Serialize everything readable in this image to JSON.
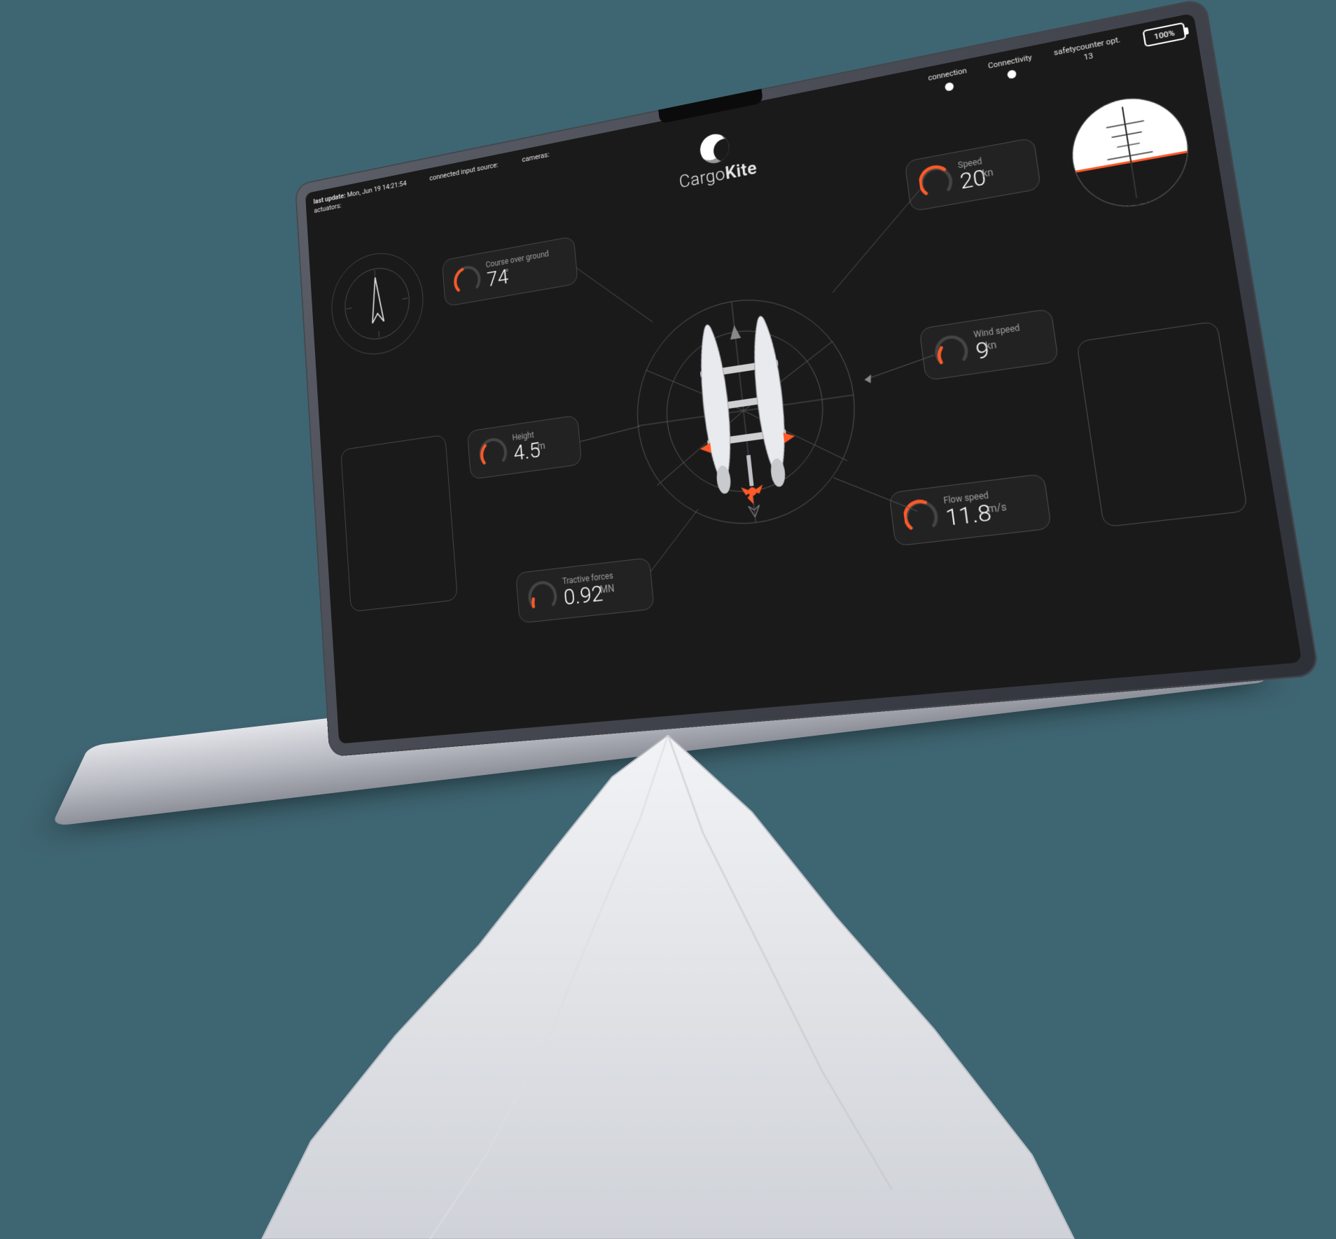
{
  "status": {
    "last_update_label": "last update:",
    "last_update_value": "Mon, Jun 19 14:21:54",
    "actuators_label": "actuators:",
    "input_source_label": "connected input source:",
    "cameras_label": "cameras:",
    "connection_label": "connection",
    "connectivity_label": "Connectivity",
    "safety_label": "safetycounter opt.",
    "safety_value": "13",
    "battery": "100%"
  },
  "brand": {
    "line1": "Cargo",
    "line2": "Kite"
  },
  "gauges": {
    "cog": {
      "label": "Course over ground",
      "value": "74",
      "unit": "°"
    },
    "speed": {
      "label": "Speed",
      "value": "20",
      "unit": "kn"
    },
    "height": {
      "label": "Height",
      "value": "4.5",
      "unit": "m"
    },
    "wind": {
      "label": "Wind speed",
      "value": "9",
      "unit": "kn"
    },
    "tractive": {
      "label": "Tractive forces",
      "value": "0.92",
      "unit": "MN"
    },
    "flow": {
      "label": "Flow speed",
      "value": "11.8",
      "unit": "m/s"
    }
  }
}
